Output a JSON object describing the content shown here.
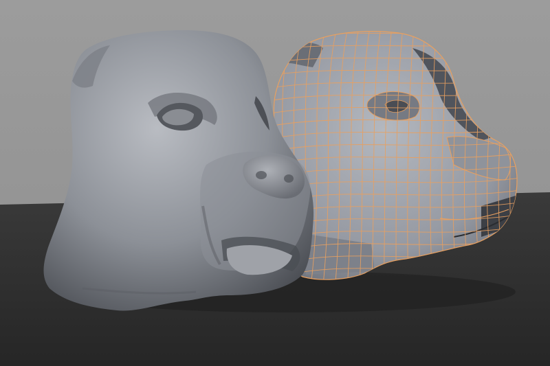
{
  "viewport": {
    "colors": {
      "background": "#9a9a9a",
      "floor": "#2f2f2f",
      "floor_horizon": "#3c3c3c",
      "mesh_shaded": "#9aa0a8",
      "mesh_dark": "#5a5e66",
      "wireframe": "#e8a060",
      "sculpt_light": "#b6b9bf",
      "sculpt_dark": "#4a4d53"
    },
    "objects": [
      {
        "name": "smooth-sculpt-dog-head",
        "shading": "smooth"
      },
      {
        "name": "low-poly-wireframe-dog-head",
        "shading": "flat-with-wireframe"
      }
    ]
  }
}
